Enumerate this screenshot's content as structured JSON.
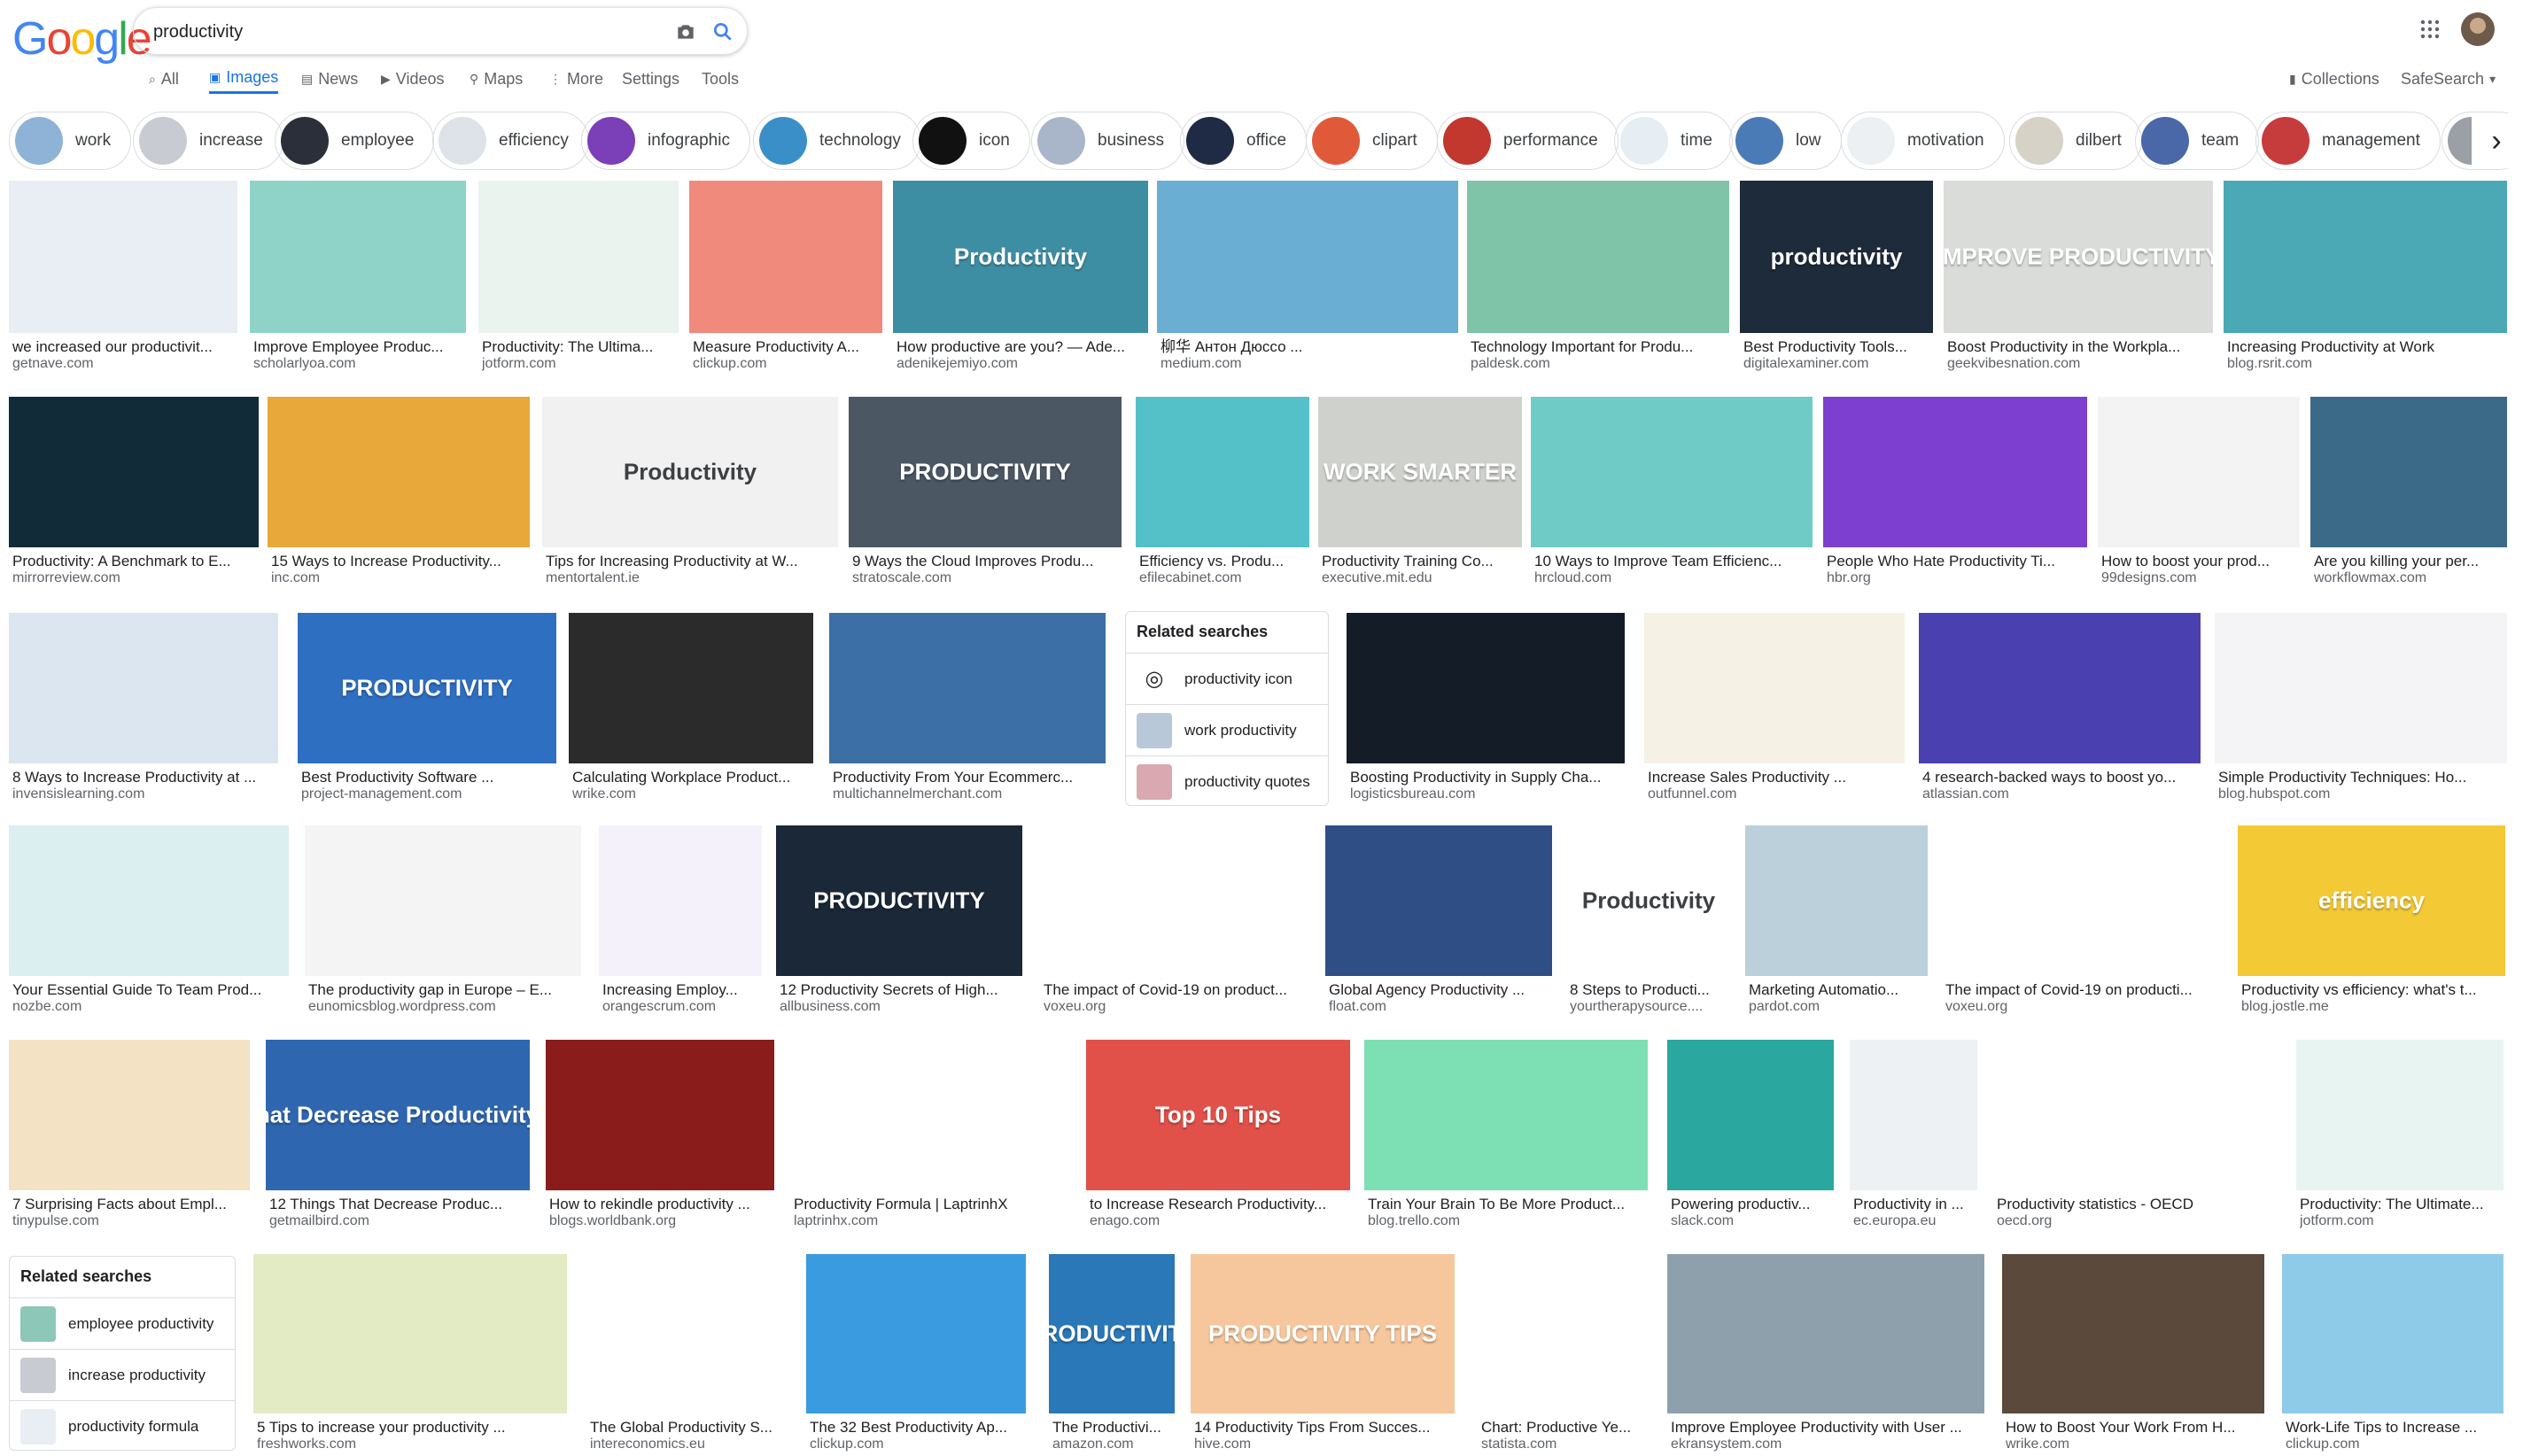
{
  "header": {
    "logo": "Google",
    "query": "productivity",
    "right_links": [
      "Collections",
      "SafeSearch"
    ]
  },
  "tabs": [
    {
      "label": "All",
      "icon": "search-icon"
    },
    {
      "label": "Images",
      "icon": "image-icon",
      "active": true
    },
    {
      "label": "News",
      "icon": "news-icon"
    },
    {
      "label": "Videos",
      "icon": "video-icon"
    },
    {
      "label": "Maps",
      "icon": "pin-icon"
    },
    {
      "label": "More",
      "icon": "more-icon"
    },
    {
      "label": "Settings"
    },
    {
      "label": "Tools"
    }
  ],
  "chips": [
    {
      "label": "work",
      "color": "#8fb3d6"
    },
    {
      "label": "increase",
      "color": "#c8ccd2"
    },
    {
      "label": "employee",
      "color": "#2b2f3a"
    },
    {
      "label": "efficiency",
      "color": "#dde3e8"
    },
    {
      "label": "infographic",
      "color": "#7b3fb8"
    },
    {
      "label": "technology",
      "color": "#3a8fc9"
    },
    {
      "label": "icon",
      "color": "#111111"
    },
    {
      "label": "business",
      "color": "#a9b6c9"
    },
    {
      "label": "office",
      "color": "#1f2a44"
    },
    {
      "label": "clipart",
      "color": "#e05a3a"
    },
    {
      "label": "performance",
      "color": "#c2372e"
    },
    {
      "label": "time",
      "color": "#e6eef4"
    },
    {
      "label": "low",
      "color": "#4b7bb7"
    },
    {
      "label": "motivation",
      "color": "#edf0f2"
    },
    {
      "label": "dilbert",
      "color": "#d6d2c8"
    },
    {
      "label": "team",
      "color": "#4a68a8"
    },
    {
      "label": "management",
      "color": "#c63b3b"
    },
    {
      "label": "",
      "color": "#9aa0a6"
    }
  ],
  "rows": [
    [
      {
        "caption": "we increased our productivit...",
        "source": "getnave.com",
        "color": "#e8eef3",
        "text": ""
      },
      {
        "caption": "Improve Employee Produc...",
        "source": "scholarlyoa.com",
        "color": "#8fd3c8",
        "text": ""
      },
      {
        "caption": "Productivity: The Ultima...",
        "source": "jotform.com",
        "color": "#eaf3ee",
        "text": ""
      },
      {
        "caption": "Measure Productivity A...",
        "source": "clickup.com",
        "color": "#f08a7d",
        "text": ""
      },
      {
        "caption": "How productive are you? — Ade...",
        "source": "adenikejemiyo.com",
        "color": "#3e8ea3",
        "text": "Productivity"
      },
      {
        "caption": "柳华 Антон Дюссо ...",
        "source": "medium.com",
        "color": "#6aaed3",
        "text": ""
      },
      {
        "caption": "Technology Important for Produ...",
        "source": "paldesk.com",
        "color": "#7fc4a8",
        "text": ""
      },
      {
        "caption": "Best Productivity Tools...",
        "source": "digitalexaminer.com",
        "color": "#1d2b3a",
        "text": "productivity"
      },
      {
        "caption": "Boost Productivity in the Workpla...",
        "source": "geekvibesnation.com",
        "color": "#d9dcd8",
        "text": "IMPROVE PRODUCTIVITY"
      },
      {
        "caption": "Increasing Productivity at Work",
        "source": "blog.rsrit.com",
        "color": "#4ba9b5",
        "text": ""
      }
    ],
    [
      {
        "caption": "Productivity: A Benchmark to E...",
        "source": "mirrorreview.com",
        "color": "#112b38",
        "text": ""
      },
      {
        "caption": "15 Ways to Increase Productivity...",
        "source": "inc.com",
        "color": "#e9a83a",
        "text": ""
      },
      {
        "caption": "Tips for Increasing Productivity at W...",
        "source": "mentortalent.ie",
        "color": "#f1f1f1",
        "text": "Productivity"
      },
      {
        "caption": "9 Ways the Cloud Improves Produ...",
        "source": "stratoscale.com",
        "color": "#4c5764",
        "text": "PRODUCTIVITY"
      },
      {
        "caption": "Efficiency vs. Produ...",
        "source": "efilecabinet.com",
        "color": "#54c1c9",
        "text": ""
      },
      {
        "caption": "Productivity Training Co...",
        "source": "executive.mit.edu",
        "color": "#cfd2cc",
        "text": "WORK SMARTER"
      },
      {
        "caption": "10 Ways to Improve Team Efficienc...",
        "source": "hrcloud.com",
        "color": "#6ecbc6",
        "text": ""
      },
      {
        "caption": "People Who Hate Productivity Ti...",
        "source": "hbr.org",
        "color": "#7c3fd0",
        "text": ""
      },
      {
        "caption": "How to boost your prod...",
        "source": "99designs.com",
        "color": "#f3f3f3",
        "text": ""
      },
      {
        "caption": "Are you killing your per...",
        "source": "workflowmax.com",
        "color": "#3a6a88",
        "text": ""
      }
    ],
    [
      {
        "caption": "8 Ways to Increase Productivity at ...",
        "source": "invensislearning.com",
        "color": "#dce6f0",
        "text": ""
      },
      {
        "caption": "Best Productivity Software ...",
        "source": "project-management.com",
        "color": "#2f6fc2",
        "text": "PRODUCTIVITY"
      },
      {
        "caption": "Calculating Workplace Product...",
        "source": "wrike.com",
        "color": "#2b2b2b",
        "text": ""
      },
      {
        "caption": "Productivity From Your Ecommerc...",
        "source": "multichannelmerchant.com",
        "color": "#3b6fa5",
        "text": ""
      },
      {
        "caption": "Boosting Productivity in Supply Cha...",
        "source": "logisticsbureau.com",
        "color": "#141c28",
        "text": ""
      },
      {
        "caption": "Increase Sales Productivity ...",
        "source": "outfunnel.com",
        "color": "#f5f1e4",
        "text": ""
      },
      {
        "caption": "4 research-backed ways to boost yo...",
        "source": "atlassian.com",
        "color": "#4b40b0",
        "text": ""
      },
      {
        "caption": "Simple Productivity Techniques: Ho...",
        "source": "blog.hubspot.com",
        "color": "#f4f4f6",
        "text": ""
      }
    ],
    [
      {
        "caption": "Your Essential Guide To Team Prod...",
        "source": "nozbe.com",
        "color": "#dbeef0",
        "text": ""
      },
      {
        "caption": "The productivity gap in Europe – E...",
        "source": "eunomicsblog.wordpress.com",
        "color": "#f4f4f4",
        "text": ""
      },
      {
        "caption": "Increasing Employ...",
        "source": "orangescrum.com",
        "color": "#f4f1fa",
        "text": ""
      },
      {
        "caption": "12 Productivity Secrets of High...",
        "source": "allbusiness.com",
        "color": "#1b2838",
        "text": "PRODUCTIVITY"
      },
      {
        "caption": "The impact of Covid-19 on product...",
        "source": "voxeu.org",
        "color": "#ffffff",
        "text": ""
      },
      {
        "caption": "Global Agency Productivity ...",
        "source": "float.com",
        "color": "#2f4e86",
        "text": ""
      },
      {
        "caption": "8 Steps to Producti...",
        "source": "yourtherapysource....",
        "color": "#ffffff",
        "text": "Productivity"
      },
      {
        "caption": "Marketing Automatio...",
        "source": "pardot.com",
        "color": "#bcd0dc",
        "text": ""
      },
      {
        "caption": "The impact of Covid-19 on producti...",
        "source": "voxeu.org",
        "color": "#ffffff",
        "text": ""
      },
      {
        "caption": "Productivity vs efficiency: what's t...",
        "source": "blog.jostle.me",
        "color": "#f3c936",
        "text": "efficiency"
      }
    ],
    [
      {
        "caption": "7 Surprising Facts about Empl...",
        "source": "tinypulse.com",
        "color": "#f4e2c4",
        "text": ""
      },
      {
        "caption": "12 Things That Decrease Produc...",
        "source": "getmailbird.com",
        "color": "#2f66b0",
        "text": "Things that Decrease Productivity at Work"
      },
      {
        "caption": "How to rekindle productivity ...",
        "source": "blogs.worldbank.org",
        "color": "#8a1c1c",
        "text": ""
      },
      {
        "caption": "Productivity Formula | LaptrinhX",
        "source": "laptrinhx.com",
        "color": "#ffffff",
        "text": ""
      },
      {
        "caption": "to Increase Research Productivity...",
        "source": "enago.com",
        "color": "#e15149",
        "text": "Top 10 Tips"
      },
      {
        "caption": "Train Your Brain To Be More Product...",
        "source": "blog.trello.com",
        "color": "#7de0b4",
        "text": ""
      },
      {
        "caption": "Powering productiv...",
        "source": "slack.com",
        "color": "#2aa79e",
        "text": ""
      },
      {
        "caption": "Productivity in ...",
        "source": "ec.europa.eu",
        "color": "#eef1f4",
        "text": ""
      },
      {
        "caption": "Productivity statistics - OECD",
        "source": "oecd.org",
        "color": "#ffffff",
        "text": ""
      },
      {
        "caption": "Productivity: The Ultimate...",
        "source": "jotform.com",
        "color": "#e8f4f2",
        "text": ""
      }
    ],
    [
      {
        "caption": "5 Tips to increase your productivity ...",
        "source": "freshworks.com",
        "color": "#e3ebc4",
        "text": ""
      },
      {
        "caption": "The Global Productivity S...",
        "source": "intereconomics.eu",
        "color": "#ffffff",
        "text": ""
      },
      {
        "caption": "The 32 Best Productivity Ap...",
        "source": "clickup.com",
        "color": "#3b9be0",
        "text": ""
      },
      {
        "caption": "The Productivi...",
        "source": "amazon.com",
        "color": "#2a78b8",
        "text": "PRODUCTIVITY"
      },
      {
        "caption": "14 Productivity Tips From Succes...",
        "source": "hive.com",
        "color": "#f6c79c",
        "text": "PRODUCTIVITY TIPS"
      },
      {
        "caption": "Chart: Productive Ye...",
        "source": "statista.com",
        "color": "#ffffff",
        "text": ""
      },
      {
        "caption": "Improve Employee Productivity with User ...",
        "source": "ekransystem.com",
        "color": "#8ea0ab",
        "text": ""
      },
      {
        "caption": "How to Boost Your Work From H...",
        "source": "wrike.com",
        "color": "#5b4a3c",
        "text": ""
      },
      {
        "caption": "Work-Life Tips to Increase ...",
        "source": "clickup.com",
        "color": "#8ecbe8",
        "text": ""
      }
    ]
  ],
  "related_1": {
    "title": "Related searches",
    "items": [
      {
        "label": "productivity icon",
        "color": "#ffffff"
      },
      {
        "label": "work productivity",
        "color": "#b8c8d8"
      },
      {
        "label": "productivity quotes",
        "color": "#d9a8b0"
      }
    ]
  },
  "related_2": {
    "title": "Related searches",
    "items": [
      {
        "label": "employee productivity",
        "color": "#8cc7b8"
      },
      {
        "label": "increase productivity",
        "color": "#c8ccd2"
      },
      {
        "label": "productivity formula",
        "color": "#e8eef3"
      }
    ]
  }
}
